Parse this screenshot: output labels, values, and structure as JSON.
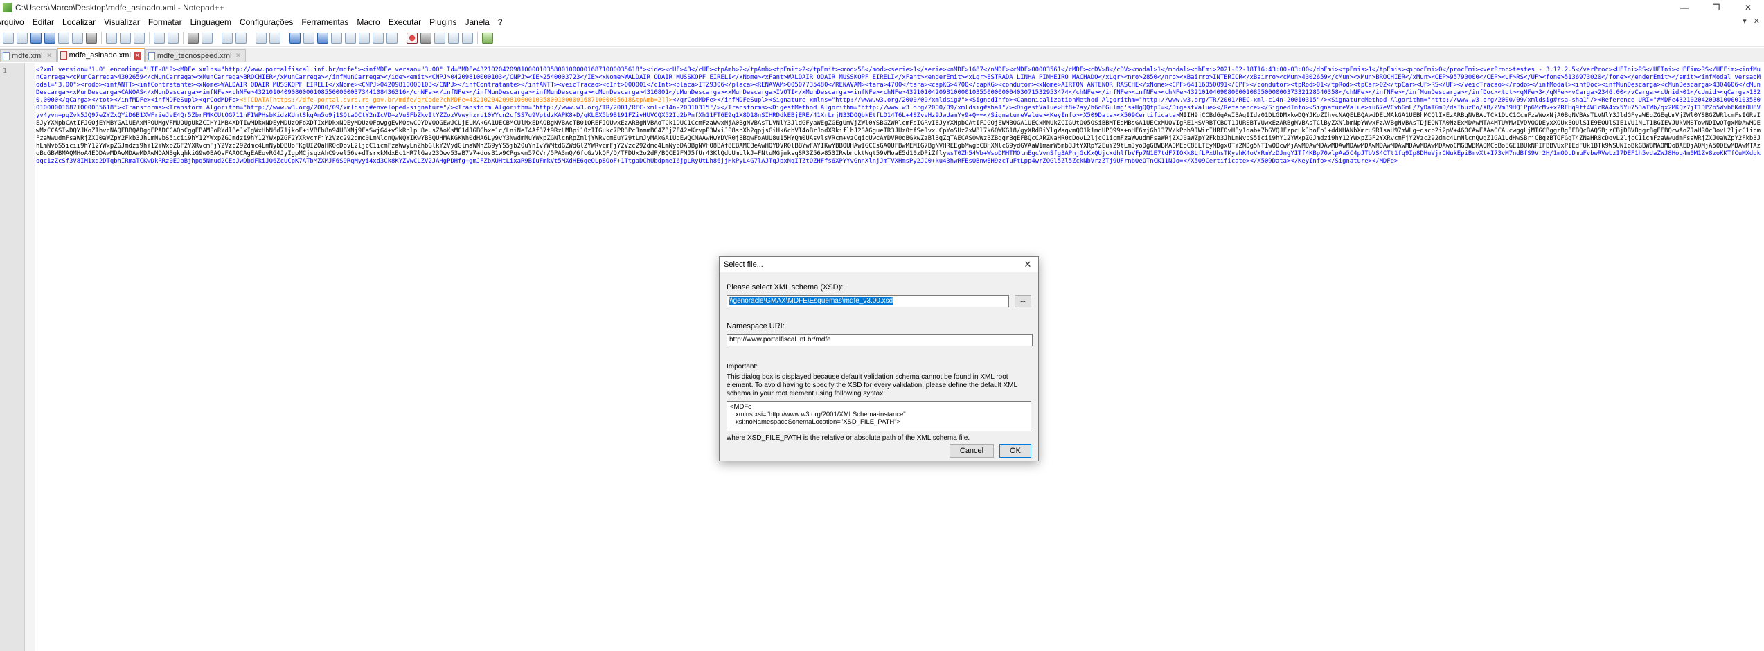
{
  "window": {
    "title": "C:\\Users\\Marco\\Desktop\\mdfe_asinado.xml - Notepad++",
    "minimize": "—",
    "maximize": "❐",
    "close": "✕"
  },
  "menu": {
    "items": [
      "Arquivo",
      "Editar",
      "Localizar",
      "Visualizar",
      "Formatar",
      "Linguagem",
      "Configurações",
      "Ferramentas",
      "Macro",
      "Executar",
      "Plugins",
      "Janela",
      "?"
    ],
    "right": [
      "▾",
      "✕"
    ]
  },
  "tabs": [
    {
      "label": "mdfe.xml",
      "active": false
    },
    {
      "label": "mdfe_asinado.xml",
      "active": true
    },
    {
      "label": "mdfe_tecnospeed.xml",
      "active": false
    }
  ],
  "editor": {
    "line_number": "1",
    "line1_prefix": "<?xml version=\"1.0\" encoding=\"UTF-8\"?><MDFe xmlns=\"http://www.portalfiscal.inf.br/mdfe\"><infMDFe versao=\"3.00\" Id=\"MDFe43210204209810000103580010000016871000035618\"><ide><cUF>43</cUF><tpAmb>2</tpAmb><tpEmit>2</tpEmit><mod>58</mod><serie>1</serie><nMDF>1687</nMDF><cMDF>00003561</cMDF><cDV>8</cDV><modal>1</modal><dhEmi>2021-02-18T16:43:00-03:00</dhEmi><tpEmis>1</tpEmis><procEmi>0</procEmi><verProc>testes - 3.12.2.5</verProc><UFIni>RS</UFIni><UFFim>RS</UFFim><infMunCarrega><cMunCarrega>4302659</cMunCarrega><xMunCarrega>BROCHIER</xMunCarrega></infMunCarrega></ide><emit><CNPJ>04209810000103</CNPJ><IE>2540003723</IE><xNome>WALDAIR ODAIR MUSSKOPF EIRELI</xNome><xFant>WALDAIR ODAIR MUSSKOPF EIRELI</xFant><enderEmit><xLgr>ESTRADA LINHA PINHEIRO MACHADO</xLgr><nro>2850</nro><xBairro>INTERIOR</xBairro><cMun>4302659</cMun><xMun>BROCHIER</xMun><CEP>95790000</CEP><UF>RS</UF><fone>5136973020</fone></enderEmit></emit><infModal versaoModal=\"3.00\"><rodo><infANTT><infContratante><xNome>WALDAIR ODAIR MUSSKOPF EIRELI</xNome><CNPJ>04209810000103</CNPJ></infContratante></infANTT><veicTracao><cInt>000001</cInt><placa>ITZ9306</placa><RENAVAM>00507735480</RENAVAM><tara>4700</tara><capKG>4700</capKG><condutor><xNome>AIRTON ANTENOR RASCHE</xNome><CPF>64116050091</CPF></condutor><tpRod>01</tpRod><tpCar>02</tpCar><UF>RS</UF></veicTracao></rodo></infModal><infDoc><infMunDescarga><cMunDescarga>4304606</cMunDescarga><xMunDescarga>CANOAS</xMunDescarga><infNFe><chNFe>43210104090800001085500000037344108436316</chNFe></infNFe></infMunDescarga><infMunDescarga><cMunDescarga>4310801</cMunDescarga><xMunDescarga>IVOTI</xMunDescarga><infNFe><chNFe>43210104209810000103550000000403071532953474</chNFe></infNFe><infNFe><chNFe>43210104090800001085500000037332128540358</chNFe></infNFe></infMunDescarga></infDoc><tot><qNFe>3</qNFe><vCarga>2346.00</vCarga><cUnid>01</cUnid><qCarga>1320.0000</qCarga></tot></infMDFe><infMDFeSupl><qrCodMDFe>",
    "line1_cdata": "<![CDATA[https://dfe-portal.svrs.rs.gov.br/mdfe/qrCode?chMDFe=43210204209810000103580010000016871000035618&tpAmb=2]]>",
    "line1_suffix": "</qrCodMDFe></infMDFeSupl><Signature xmlns=\"http://www.w3.org/2000/09/xmldsig#\"><SignedInfo><CanonicalizationMethod Algorithm=\"http://www.w3.org/TR/2001/REC-xml-c14n-20010315\"/><SignatureMethod Algorithm=\"http://www.w3.org/2000/09/xmldsig#rsa-sha1\"/><Reference URI=\"#MDFe43210204209810000103580010000016871000035618\"><Transforms><Transform Algorithm=\"http://www.w3.org/2000/09/xmldsig#enveloped-signature\"/><Transform Algorithm=\"http://www.w3.org/TR/2001/REC-xml-c14n-20010315\"/></Transforms><DigestMethod Algorithm=\"http://www.w3.org/2000/09/xmldsig#sha1\"/><DigestValue>Hf8+7ay/h6oEGulmg's+HgQQfpI=</DigestValue></Reference></SignedInfo><SignatureValue>iu67eVCvhGmL/7yDaTGmD/dsIhuzBo/XB/ZVm39HQ1Pp6McMv+x2RFHq9ft4W1cRA4xx5Yu753aTWb/qx2MKQz7jT1DPZb5Wvb6Kdf0U8Vyv4yvn+pqZvk5JQ97eZYZxQYiD6B1XWFrieJvE4Qr5ZbrFMKCUtOG711nFIWPHsbKidzKUntSkqAm5o9j1SQtaOCtY2nIcVD+zVuSFbZkvItYZZozVVwyhzru10YYcn2cfSS7u9VptdzKAPK8+D/qKLEX5b9B191FZivHUVCQX52Ig2bPnfXh11FT6E9q1X8D18nSIHRDdkEBjERE/41XrLrjN33DOQbkEtfLD14T6L+4SZvvHz9JwUamYy9+Q==</SignatureValue><KeyInfo><X509Data><X509Certificate>",
    "line1_cert": "MIIH9jCCBd6gAwIBAgIIdz01DLGDMxkwDQYJKoZIhvcNAQELBQAwdDELMAkGA1UEBhMCQlIxEzARBgNVBAoTCk1DUC1CcmFzaWwxNjA0BgNVBAsTLVNlY3JldGFyaWEgZGEgUmVjZWl0YSBGZWRlcmFsIGRvIEJyYXNpbCAtIFJGQjEYMBYGA1UEAxMPQUMgVFMUQUgUkZCIHY1MB4XDTIwMDkxNDEyMDUzOFoXDTIxMDkxNDEyMDUzOFowggEvMQswCQYDVQQGEwJCUjELMAkGA1UECBMCUlMxEDAOBgNVBAcTB01OREFJQUwxEzARBgNVBAoTCk1DUC1CcmFzaWwxNjA0BgNVBAsTLVNlY3JldGFyaWEgZGEgUmVjZWl0YSBGZWRlcmFsIGRvIEJyYXNpbCAtIFJGQjEWMBQGA1UECxMNUkZCIGUtQ05QSiBBMTEdMBsGA1UECxMUQVIgRE1HSVRBTCBOT1JURSBTVUwxEzARBgNVBAsTClByZXNlbmNpYWwxFzAVBgNVBAsTDjEONTA0NzExMDAwMTA4MTUWMwIVDVQQDEyxXQUxEQUlSIE9EQUlSIE1VU1NLT1BGIEVJUkVMSTowNDIwOTgxMDAwMDEwMzCCASIwDQYJKoZIhvcNAQEBBQADggEPADCCAQoCggEBAMPoRYdlBeJxIgWxHbN6d71jkoF+iVBEb8n94UBXNj9FaSwjG4+vSkRhlpU8eusZAoKsMC1dJGBGbxe1c/LniNeI4Af37t9RzLMBpi10zITGukc7PR3PcJnmmBC4Z3jZF42eKrvpP3WxiJP8shXh2qpjsGiHk6cbVI4oBrJodX9kiflhJ2SAGgueIR3JUz0tfSeJvxuCpYoSUz2xW8l7k6QWKG18/gyXRdRiYlgWaqvmQO1k1mdUPQ99s+nHE6mjGh137V/kPbh9JWirIHRF0vHEy1dab+7bGVQJFzpcLkJhoFp1+ddXHANbXmruSRIsaU97mWLg+dscp2i2pV+460CAwEAAaOCAucwggLjMIGCBggrBgEFBQcBAQSBjzCBjDBVBggrBgEFBQcwAoZJaHR0cDovL2ljcC1icmFzaWwudmFsaWRjZXJ0aWZpY2Fkb3JhLmNvbS5icii9hY12YWxpZGJmdzi9hY12YWxpZGF2YXRvcmFjY2Vzc292dmc0LmNlcnQwNQYIKwYBBQUHMAKGKWh0dHA6Ly9vY3NwdmMuYWxpZGNlcnRpZmljYWRvcmEuY29tLmJyMAkGA1UdEwQCMAAwHwYDVR0jBBgwFoAUU8u15HYQm0UAsvlsVRcm+yzCqicUwcAYDVR0gBGkwZzBlBgZgTAECAS0wWzBZBggrBgEFBQcCARZNaHR0cDovL2ljcC1icmFzaWwudmFsaWRjZXJ0aWZpY2Fkb3JhLmNvbS5icii9hY12YWxpZGJmdzi9hY12YWxpZGF2YXRvcmFjY2Vzc292dmc4LmNlcnQwgZ1GA1UdHwSBrjCBqzBTOFGgT4ZNaHR0cDovL2ljcC1icmFzaWwudmFsaWRjZXJ0aWZpY2Fkb3JhLmNvbS5icii9hY12YWxpZGJmdzi9hY12YWxpZGF2YXRvcmFjY2Vzc292dmc4LmNybDBUoFKgUIZOaHR0cDovL2ljcC1icmFzaWwyLnZhbGlkY2VydGlmaWNhZG9yYS5jb20uYnIvYWMtdGZWdGl2YWRvcmFjY2Vzc292dmc4LmNybDAOBgNVHQ8BAf8EBAMCBeAwHQYDVR0lBBYwFAYIKwYBBQUHAwIGCCsGAQUFBwMEMIG7BgNVHREEgbMwgbCBHXNlcG9ydGVAaW1mamW5mb3JtYXRpY2EuY29tLmJyoDgGBWBMAQMEoC8ELTEyMDgxOTY2NDg5NTIwODcwMjAwMDAwMDAwMDAwMDAwMDAwMDAwMDAwMDAwMDAwMDAwoCMGBWBMAQMCoBoEGE1BUkNPIFBBVUxPIEdFUk1BTk9WSUNIoBkGBWBMAQMDoBAEDjA0MjA5ODEwMDAwMTAzoBcGBWBMAQMHoA4EDDAwMDAwMDAwMDAwMDANBgkqhkiG9w0BAQsFAAOCAgEAEovRG4JyIgpMCjsqzAhC9vel56v+dTsrxkMdxEc1HR7lGaz23Dwv53aB7V7+dosB1w9CPgswm57CVr/5PA3mQ/6fcGzVkQF/D/TFDUx2o2dP/BQCE2FMJ5fUr43KlQdUUmLlkJ+FNtuMGjmksqSR3Z56w853IRwbncktWqt59VMoaE5d10zDPiZfly",
    "line1_end": "wsT0Zh54Wb+WsoDMHTMOtmEgcVvnSfg3APhjGcKxQUjcxdhlfbVFp7N1E7tdF7IOKk8LfLPxUhsTKyvhK4oVxRmYzDJngYITf4KBp70wlpAa5C4pJTbVS4CTt1fq9Ip8DHuVjrCNukEpiBmvXt+I73vM7ndBfS9Vr2H/1mODcDmuFvbwRVwLzI7DEF1h5vdaZWJ8Hoq4m0M1Zv8zoKKTfCuMXdqkoqc1zZcSf3V8IM1xd2DTqbhIRmaTCKwDkRRz0EJpBjhpq5Nmud2CEoJwDbdFkiJQ6ZcUCpK7ATbMZXMJF6S9RqMyyi4xd3Ck8KYZVwCLZV2JAHgPDHfg+gmJFZbXUHtLixaR9BIuFmkVt5MXdHE6qeQLp8OoF+1TtgaDChUbdpmeI6jgLRyUtLh86jjHkPyL4G7lAJTqJpxNqITZtOZHFfs6XPYYvGnnXlnjJmTVXHmsPy2JC0+ku43hwRFEsQBnwEH9zcTuFtLpp4wrZQGl5Zl5ZckNbVrzZTj9UFrnbQeOTnCK11NJo=</X509Certificate></X509Data></KeyInfo></Signature></MDFe>"
  },
  "dialog": {
    "title": "Select file...",
    "close": "✕",
    "schema_label": "Please select XML schema (XSD):",
    "schema_value": "\\\\genoracle\\GMAX\\MDFE\\Esquemas\\mdfe_v3.00.xsd",
    "browse_label": "...",
    "namespace_label": "Namespace URI:",
    "namespace_value": "http://www.portalfiscal.inf.br/mdfe",
    "important_label": "Important:",
    "important_text": "This dialog box is displayed because default validation schema cannot be found in XML root element. To avoid having to specify the XSD for every validation, please define the default XML schema in your root element using following syntax:",
    "syntax_line1": "<MDFe",
    "syntax_line2": "xmlns:xsi=\"http://www.w3.org/2001/XMLSchema-instance\"",
    "syntax_line3": "xsi:noNamespaceSchemaLocation=\"XSD_FILE_PATH\">",
    "hint": "where XSD_FILE_PATH is the relative or absolute path of the XML schema file.",
    "cancel_label": "Cancel",
    "ok_label": "OK"
  },
  "colors": {
    "tag": "#0000ff",
    "attribute": "#ff0000",
    "attribute_value": "#8000ff",
    "cdata": "#ff8000",
    "active_tab_accent": "#f7a535",
    "selection": "#0078d7"
  }
}
